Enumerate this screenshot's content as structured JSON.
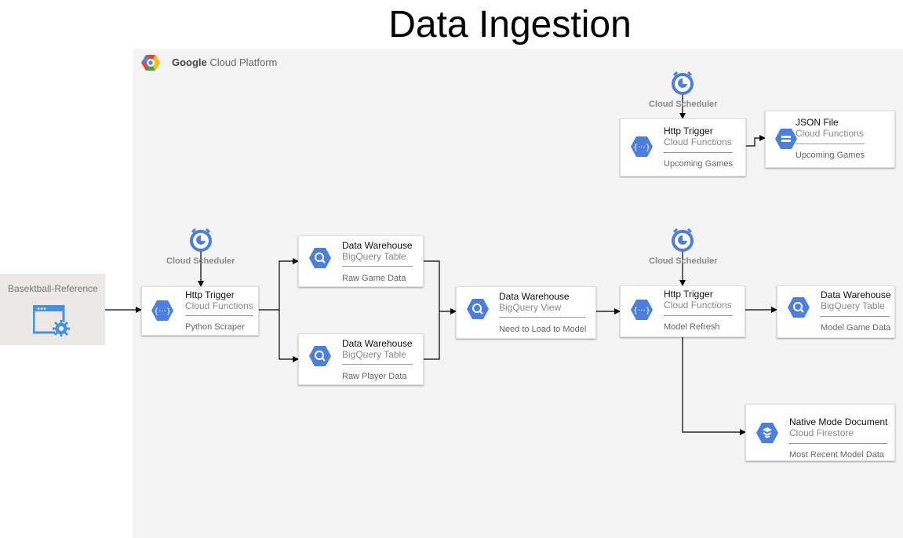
{
  "title": "Data Ingestion",
  "platform": {
    "brand": "Google",
    "name": "Cloud Platform"
  },
  "source": {
    "label": "Basektball-Reference",
    "icon": "web-app-settings-icon"
  },
  "schedulers": [
    {
      "id": "sched-1",
      "label": "Cloud Scheduler",
      "icon": "clock-icon"
    },
    {
      "id": "sched-2",
      "label": "Cloud Scheduler",
      "icon": "clock-icon"
    },
    {
      "id": "sched-3",
      "label": "Cloud Scheduler",
      "icon": "clock-icon"
    }
  ],
  "nodes": {
    "python_scraper": {
      "title": "Http Trigger",
      "service": "Cloud Functions",
      "footer": "Python Scraper",
      "icon": "cloud-functions-icon"
    },
    "raw_game": {
      "title": "Data Warehouse",
      "service": "BigQuery Table",
      "footer": "Raw Game Data",
      "icon": "bigquery-icon"
    },
    "raw_player": {
      "title": "Data Warehouse",
      "service": "BigQuery Table",
      "footer": "Raw Player Data",
      "icon": "bigquery-icon"
    },
    "view": {
      "title": "Data Warehouse",
      "service": "BigQuery View",
      "footer": "Need to Load to Model",
      "icon": "bigquery-icon"
    },
    "model_refresh": {
      "title": "Http Trigger",
      "service": "Cloud Functions",
      "footer": "Model Refresh",
      "icon": "cloud-functions-icon"
    },
    "model_game": {
      "title": "Data Warehouse",
      "service": "BigQuery Table",
      "footer": "Model Game Data",
      "icon": "bigquery-icon"
    },
    "firestore": {
      "title": "Native Mode Document",
      "service": "Cloud Firestore",
      "footer": "Most Recent Model Data",
      "icon": "firestore-icon"
    },
    "upcoming_fn": {
      "title": "Http Trigger",
      "service": "Cloud Functions",
      "footer": "Upcoming Games",
      "icon": "cloud-functions-icon"
    },
    "json_file": {
      "title": "JSON File",
      "service": "Cloud Functions",
      "footer": "Upcoming Games",
      "icon": "storage-icon"
    }
  },
  "colors": {
    "gcp_blue": "#4a7fe0",
    "panel": "#f4f4f4",
    "source_bg": "#ebe8e5"
  }
}
